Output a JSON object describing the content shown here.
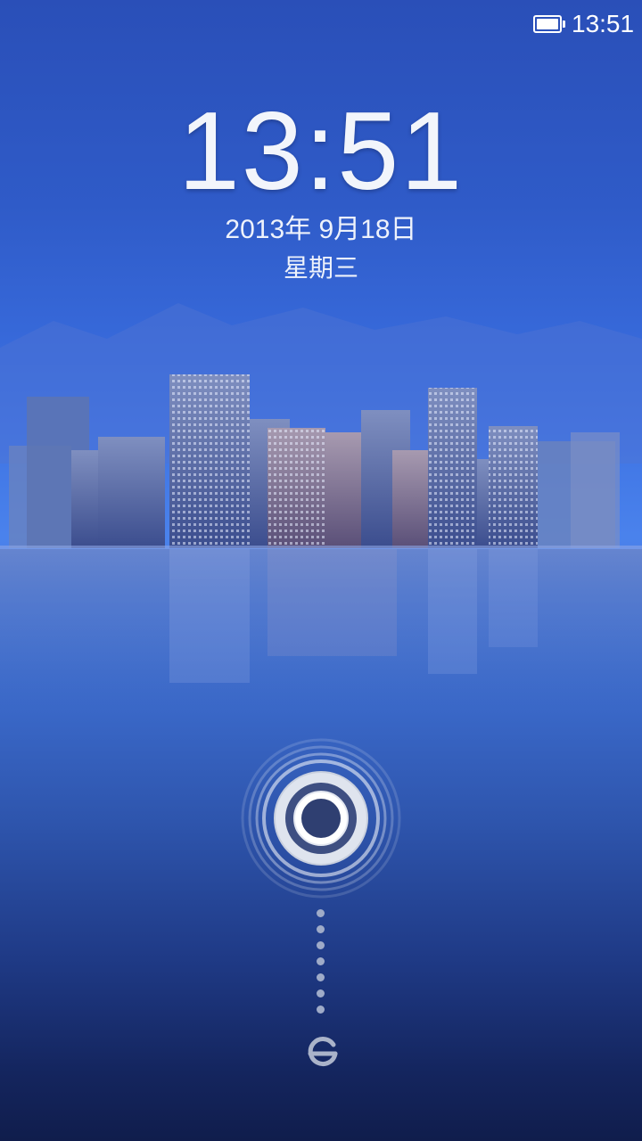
{
  "status_bar": {
    "time": "13:51",
    "battery_icon": "battery-icon"
  },
  "lock_screen": {
    "clock": "13:51",
    "date": "2013年 9月18日",
    "weekday": "星期三"
  },
  "unlock": {
    "handle_icon": "unlock-ring-icon",
    "target_icon": "unlock-target-icon",
    "track_dot_count": 7
  },
  "colors": {
    "accent": "#3a6ee0",
    "text": "#ffffff",
    "dot": "#9fabc8"
  }
}
